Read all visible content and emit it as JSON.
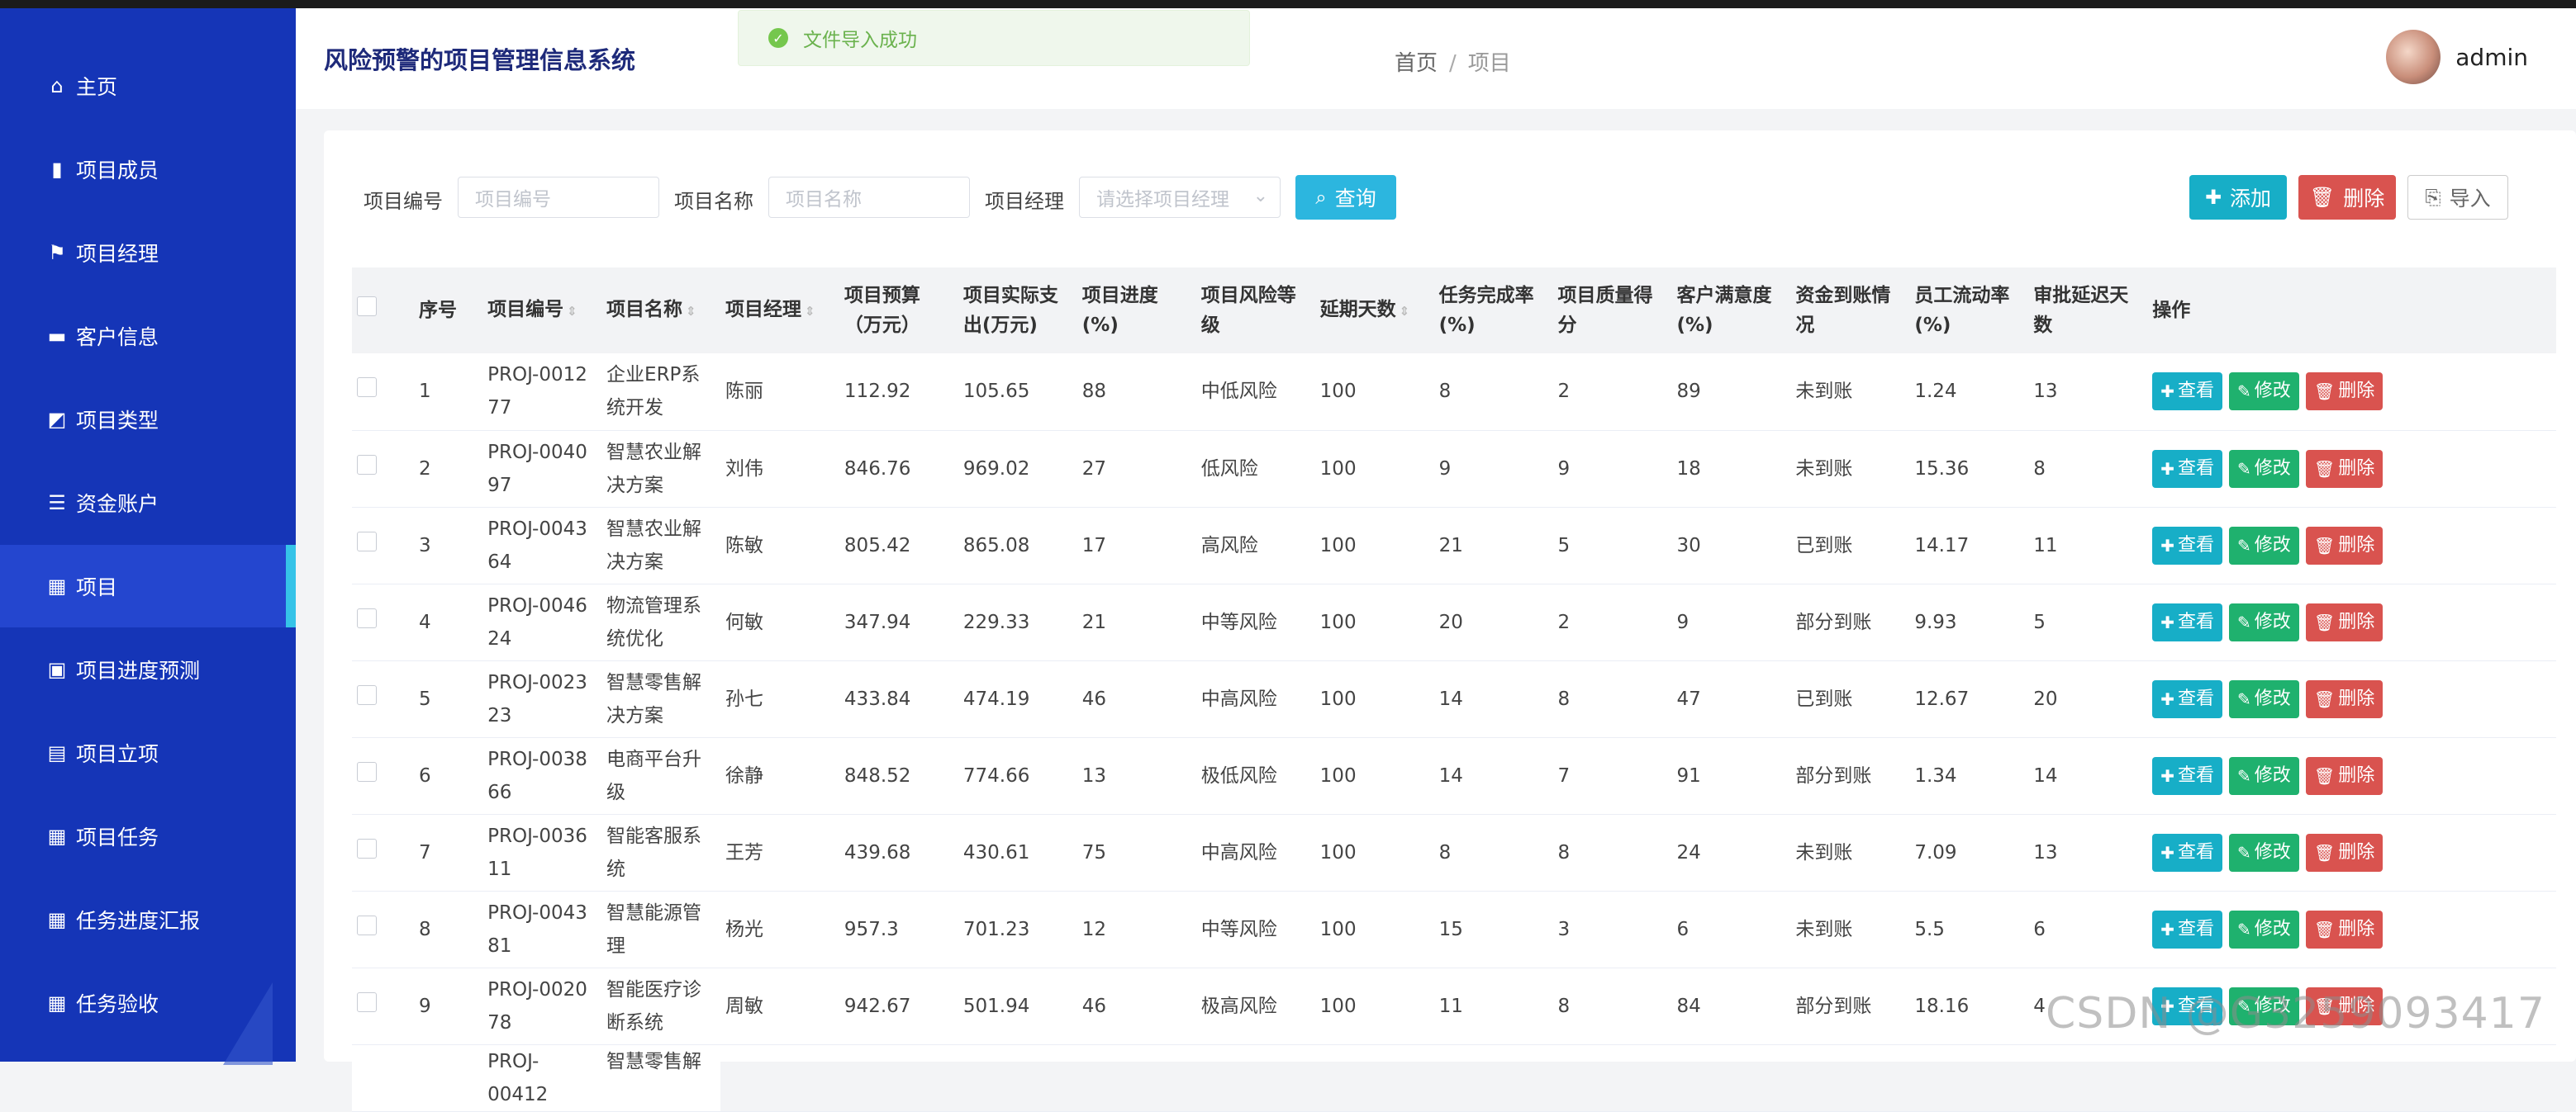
{
  "app": {
    "title": "风险预警的项目管理信息系统"
  },
  "toast": {
    "message": "文件导入成功"
  },
  "breadcrumb": {
    "home": "首页",
    "current": "项目"
  },
  "user": {
    "name": "admin"
  },
  "sidebar": {
    "items": [
      {
        "label": "主页",
        "icon": "home-icon"
      },
      {
        "label": "项目成员",
        "icon": "building-icon"
      },
      {
        "label": "项目经理",
        "icon": "flag-icon"
      },
      {
        "label": "客户信息",
        "icon": "printer-icon"
      },
      {
        "label": "项目类型",
        "icon": "chart-icon"
      },
      {
        "label": "资金账户",
        "icon": "list-icon"
      },
      {
        "label": "项目",
        "icon": "grid-icon",
        "active": true
      },
      {
        "label": "项目进度预测",
        "icon": "briefcase-icon"
      },
      {
        "label": "项目立项",
        "icon": "book-icon"
      },
      {
        "label": "项目任务",
        "icon": "grid-icon"
      },
      {
        "label": "任务进度汇报",
        "icon": "grid-icon"
      },
      {
        "label": "任务验收",
        "icon": "grid-icon"
      }
    ]
  },
  "filters": {
    "code_label": "项目编号",
    "code_placeholder": "项目编号",
    "name_label": "项目名称",
    "name_placeholder": "项目名称",
    "manager_label": "项目经理",
    "manager_placeholder": "请选择项目经理",
    "query_label": "查询"
  },
  "toolbar": {
    "add_label": "添加",
    "delete_label": "删除",
    "import_label": "导入"
  },
  "table": {
    "headers": [
      "序号",
      "项目编号",
      "项目名称",
      "项目经理",
      "项目预算（万元）",
      "项目实际支出(万元)",
      "项目进度(%)",
      "项目风险等级",
      "延期天数",
      "任务完成率(%)",
      "项目质量得分",
      "客户满意度(%)",
      "资金到账情况",
      "员工流动率(%)",
      "审批延迟天数",
      "操作"
    ],
    "actions": {
      "view": "查看",
      "edit": "修改",
      "delete": "删除"
    },
    "rows": [
      [
        "1",
        "PROJ-001277",
        "企业ERP系统开发",
        "陈丽",
        "112.92",
        "105.65",
        "88",
        "中低风险",
        "100",
        "8",
        "2",
        "89",
        "未到账",
        "1.24",
        "13"
      ],
      [
        "2",
        "PROJ-004097",
        "智慧农业解决方案",
        "刘伟",
        "846.76",
        "969.02",
        "27",
        "低风险",
        "100",
        "9",
        "9",
        "18",
        "未到账",
        "15.36",
        "8"
      ],
      [
        "3",
        "PROJ-004364",
        "智慧农业解决方案",
        "陈敏",
        "805.42",
        "865.08",
        "17",
        "高风险",
        "100",
        "21",
        "5",
        "30",
        "已到账",
        "14.17",
        "11"
      ],
      [
        "4",
        "PROJ-004624",
        "物流管理系统优化",
        "何敏",
        "347.94",
        "229.33",
        "21",
        "中等风险",
        "100",
        "20",
        "2",
        "9",
        "部分到账",
        "9.93",
        "5"
      ],
      [
        "5",
        "PROJ-002323",
        "智慧零售解决方案",
        "孙七",
        "433.84",
        "474.19",
        "46",
        "中高风险",
        "100",
        "14",
        "8",
        "47",
        "已到账",
        "12.67",
        "20"
      ],
      [
        "6",
        "PROJ-003866",
        "电商平台升级",
        "徐静",
        "848.52",
        "774.66",
        "13",
        "极低风险",
        "100",
        "14",
        "7",
        "91",
        "部分到账",
        "1.34",
        "14"
      ],
      [
        "7",
        "PROJ-003611",
        "智能客服系统",
        "王芳",
        "439.68",
        "430.61",
        "75",
        "中高风险",
        "100",
        "8",
        "8",
        "24",
        "未到账",
        "7.09",
        "13"
      ],
      [
        "8",
        "PROJ-004381",
        "智慧能源管理",
        "杨光",
        "957.3",
        "701.23",
        "12",
        "中等风险",
        "100",
        "15",
        "3",
        "6",
        "未到账",
        "5.5",
        "6"
      ],
      [
        "9",
        "PROJ-002078",
        "智能医疗诊断系统",
        "周敏",
        "942.67",
        "501.94",
        "46",
        "极高风险",
        "100",
        "11",
        "8",
        "84",
        "部分到账",
        "18.16",
        "4"
      ]
    ],
    "partial_row": {
      "code": "PROJ-00412",
      "name": "智慧零售解"
    }
  },
  "watermark": "CSDN @G3259093417"
}
